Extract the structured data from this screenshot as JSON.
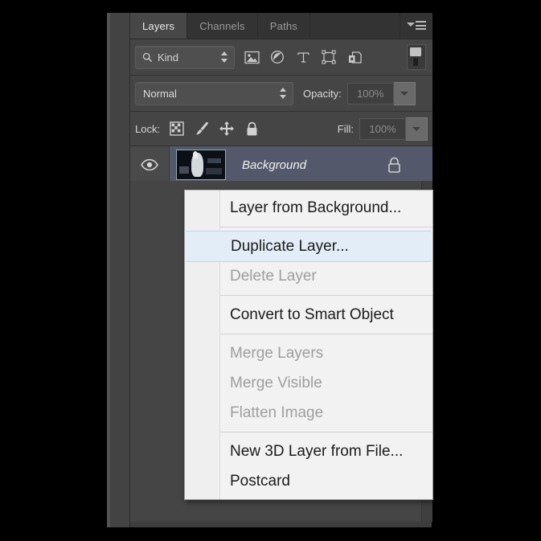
{
  "panel": {
    "tabs": [
      {
        "label": "Layers",
        "active": true,
        "name": "tab-layers"
      },
      {
        "label": "Channels",
        "active": false,
        "name": "tab-channels"
      },
      {
        "label": "Paths",
        "active": false,
        "name": "tab-paths"
      }
    ],
    "menu_icon": "panel-menu-icon",
    "filter": {
      "search_icon": "magnifier-icon",
      "kind_label": "Kind",
      "spinner_icon": "spinner-updown-icon",
      "icons": [
        {
          "name": "filter-pixel-icon",
          "title": "Pixel Layers"
        },
        {
          "name": "filter-adjustment-icon",
          "title": "Adjustment Layers"
        },
        {
          "name": "filter-type-icon",
          "title": "Type Layers"
        },
        {
          "name": "filter-shape-icon",
          "title": "Shape Layers"
        },
        {
          "name": "filter-smartobject-icon",
          "title": "Smart Objects"
        }
      ],
      "toggle_name": "filter-enable-toggle"
    },
    "blend": {
      "mode": "Normal",
      "mode_spinner_icon": "spinner-updown-icon",
      "opacity_label": "Opacity:",
      "opacity_value": "100%",
      "opacity_arrow_icon": "chevron-down-icon"
    },
    "lock": {
      "label": "Lock:",
      "icons": [
        {
          "name": "lock-transparency-icon",
          "title": "Lock transparent pixels"
        },
        {
          "name": "lock-image-brush-icon",
          "title": "Lock image pixels"
        },
        {
          "name": "lock-position-move-icon",
          "title": "Lock position"
        },
        {
          "name": "lock-all-padlock-icon",
          "title": "Lock all"
        }
      ],
      "fill_label": "Fill:",
      "fill_value": "100%",
      "fill_arrow_icon": "chevron-down-icon"
    },
    "layers": [
      {
        "name": "Background",
        "visible": true,
        "locked": true,
        "selected": true,
        "eye_icon": "eye-visibility-icon",
        "lock_icon": "padlock-icon"
      }
    ]
  },
  "context_menu": {
    "items": [
      {
        "label": "Layer from Background...",
        "enabled": true,
        "selected": false,
        "separator_after": true,
        "name": "menu-item-layer-from-background"
      },
      {
        "label": "Duplicate Layer...",
        "enabled": true,
        "selected": true,
        "separator_after": false,
        "name": "menu-item-duplicate-layer"
      },
      {
        "label": "Delete Layer",
        "enabled": false,
        "selected": false,
        "separator_after": true,
        "name": "menu-item-delete-layer"
      },
      {
        "label": "Convert to Smart Object",
        "enabled": true,
        "selected": false,
        "separator_after": true,
        "name": "menu-item-convert-to-smart-object"
      },
      {
        "label": "Merge Layers",
        "enabled": false,
        "selected": false,
        "separator_after": false,
        "name": "menu-item-merge-layers"
      },
      {
        "label": "Merge Visible",
        "enabled": false,
        "selected": false,
        "separator_after": false,
        "name": "menu-item-merge-visible"
      },
      {
        "label": "Flatten Image",
        "enabled": false,
        "selected": false,
        "separator_after": true,
        "name": "menu-item-flatten-image"
      },
      {
        "label": "New 3D Layer from File...",
        "enabled": true,
        "selected": false,
        "separator_after": false,
        "name": "menu-item-new-3d-layer-from-file"
      },
      {
        "label": "Postcard",
        "enabled": true,
        "selected": false,
        "separator_after": false,
        "name": "menu-item-postcard"
      }
    ]
  },
  "colors": {
    "page_background": "#000000",
    "workspace": "#3d3d3d",
    "panel_background": "#454545",
    "tabstrip": "#333333",
    "tab_active": "#474747",
    "layer_selected": "#53596b",
    "menu_background": "#f2f2f2",
    "menu_highlight": "#e3edf7",
    "menu_text": "#1b1b1b",
    "menu_text_disabled": "#9e9e9e"
  }
}
